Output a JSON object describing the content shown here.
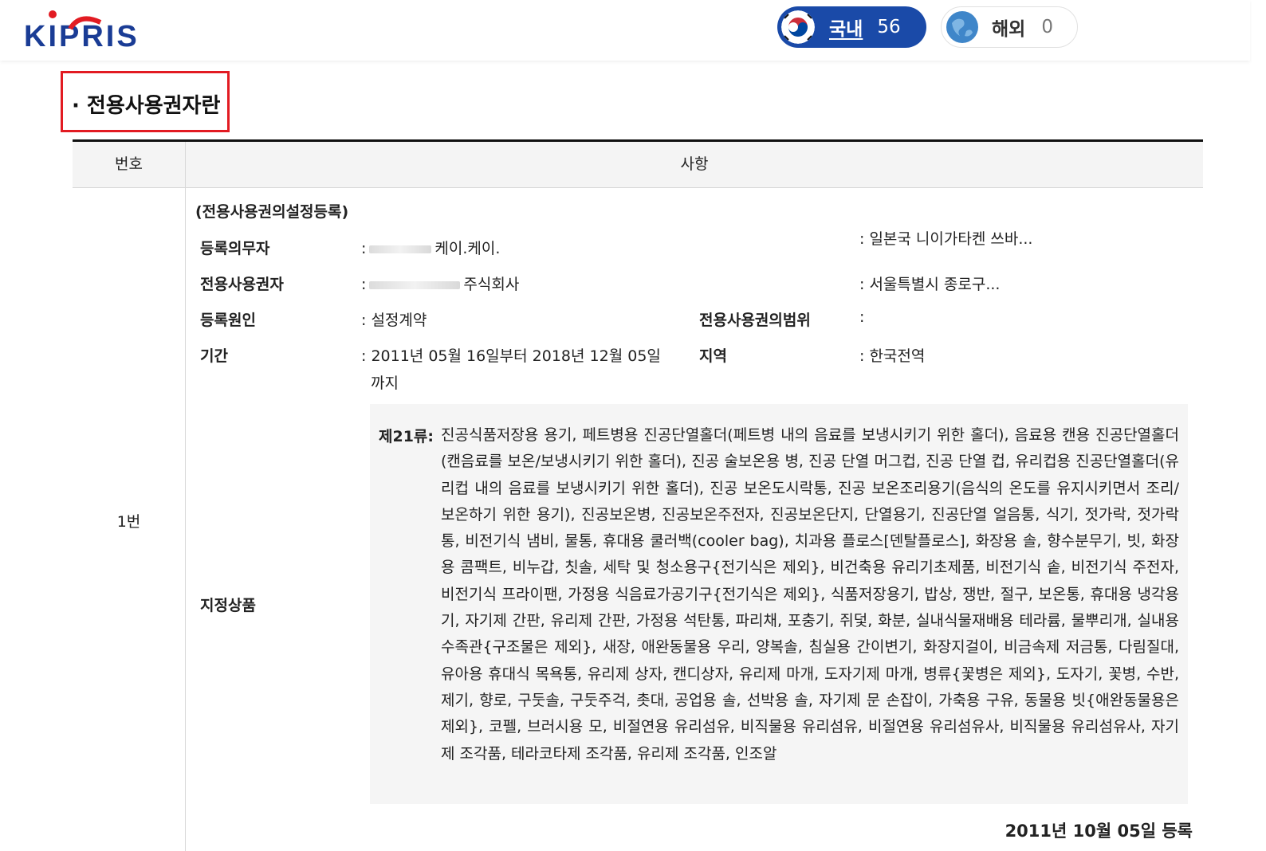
{
  "header": {
    "logo_text": "KIPRIS",
    "domestic": {
      "label": "국내",
      "count": "56",
      "icon": "korea-flag-icon"
    },
    "overseas": {
      "label": "해외",
      "count": "0",
      "icon": "globe-icon"
    }
  },
  "section": {
    "title": "· 전용사용권자란"
  },
  "table": {
    "headers": {
      "number": "번호",
      "details": "사항"
    },
    "row": {
      "number": "1번",
      "type": "(전용사용권의설정등록)",
      "registrant_label": "등록의무자",
      "registrant_value": "케이.케이.",
      "registrant_address": ": 일본국 니이가타켄 쓰바...",
      "licensee_label": "전용사용권자",
      "licensee_value": "주식회사",
      "licensee_address": ": 서울특별시 종로구...",
      "cause_label": "등록원인",
      "cause_value": ": 설정계약",
      "scope_label": "전용사용권의범위",
      "scope_value": ":",
      "period_label": "기간",
      "period_value_line1": ": 2011년 05월 16일부터 2018년 12월 05일",
      "period_value_line2": "까지",
      "region_label": "지역",
      "region_value": ": 한국전역",
      "goods_label": "지정상품",
      "goods_class": "제21류:",
      "goods_text": "진공식품저장용 용기, 페트병용 진공단열홀더(페트병 내의 음료를 보냉시키기 위한 홀더), 음료용 캔용 진공단열홀더(캔음료를 보온/보냉시키기 위한 홀더), 진공 술보온용 병, 진공 단열 머그컵, 진공 단열 컵, 유리컵용 진공단열홀더(유리컵 내의 음료를 보냉시키기 위한 홀더), 진공 보온도시락통, 진공 보온조리용기(음식의 온도를 유지시키면서 조리/보온하기 위한 용기), 진공보온병, 진공보온주전자, 진공보온단지, 단열용기, 진공단열 얼음통, 식기, 젓가락, 젓가락 통, 비전기식 냄비, 물통, 휴대용 쿨러백(cooler bag), 치과용 플로스[덴탈플로스], 화장용 솔, 향수분무기, 빗, 화장용 콤팩트, 비누갑, 칫솔, 세탁 및 청소용구{전기식은 제외}, 비건축용 유리기초제품, 비전기식 솥, 비전기식 주전자, 비전기식 프라이팬, 가정용 식음료가공기구{전기식은 제외}, 식품저장용기, 밥상, 쟁반, 절구, 보온통, 휴대용 냉각용기, 자기제 간판, 유리제 간판, 가정용 석탄통, 파리채, 포충기, 쥐덫, 화분, 실내식물재배용 테라륨, 물뿌리개, 실내용 수족관{구조물은 제외}, 새장, 애완동물용 우리, 양복솔, 침실용 간이변기, 화장지걸이, 비금속제 저금통, 다림질대, 유아용 휴대식 목욕통, 유리제 상자, 캔디상자, 유리제 마개, 도자기제 마개, 병류{꽃병은 제외}, 도자기, 꽃병, 수반, 제기, 향로, 구둣솔, 구둣주걱, 촛대, 공업용 솔, 선박용 솔, 자기제 문 손잡이, 가축용 구유, 동물용 빗{애완동물용은 제외}, 코펠, 브러시용 모, 비절연용 유리섬유, 비직물용 유리섬유, 비절연용 유리섬유사, 비직물용 유리섬유사, 자기제 조각품, 테라코타제 조각품, 유리제 조각품, 인조알",
      "registration_date": "2011년 10월 05일 등록"
    }
  },
  "colors": {
    "brand_blue": "#1a4aa8",
    "brand_red": "#e21b22",
    "highlight_red": "#e21b22"
  }
}
